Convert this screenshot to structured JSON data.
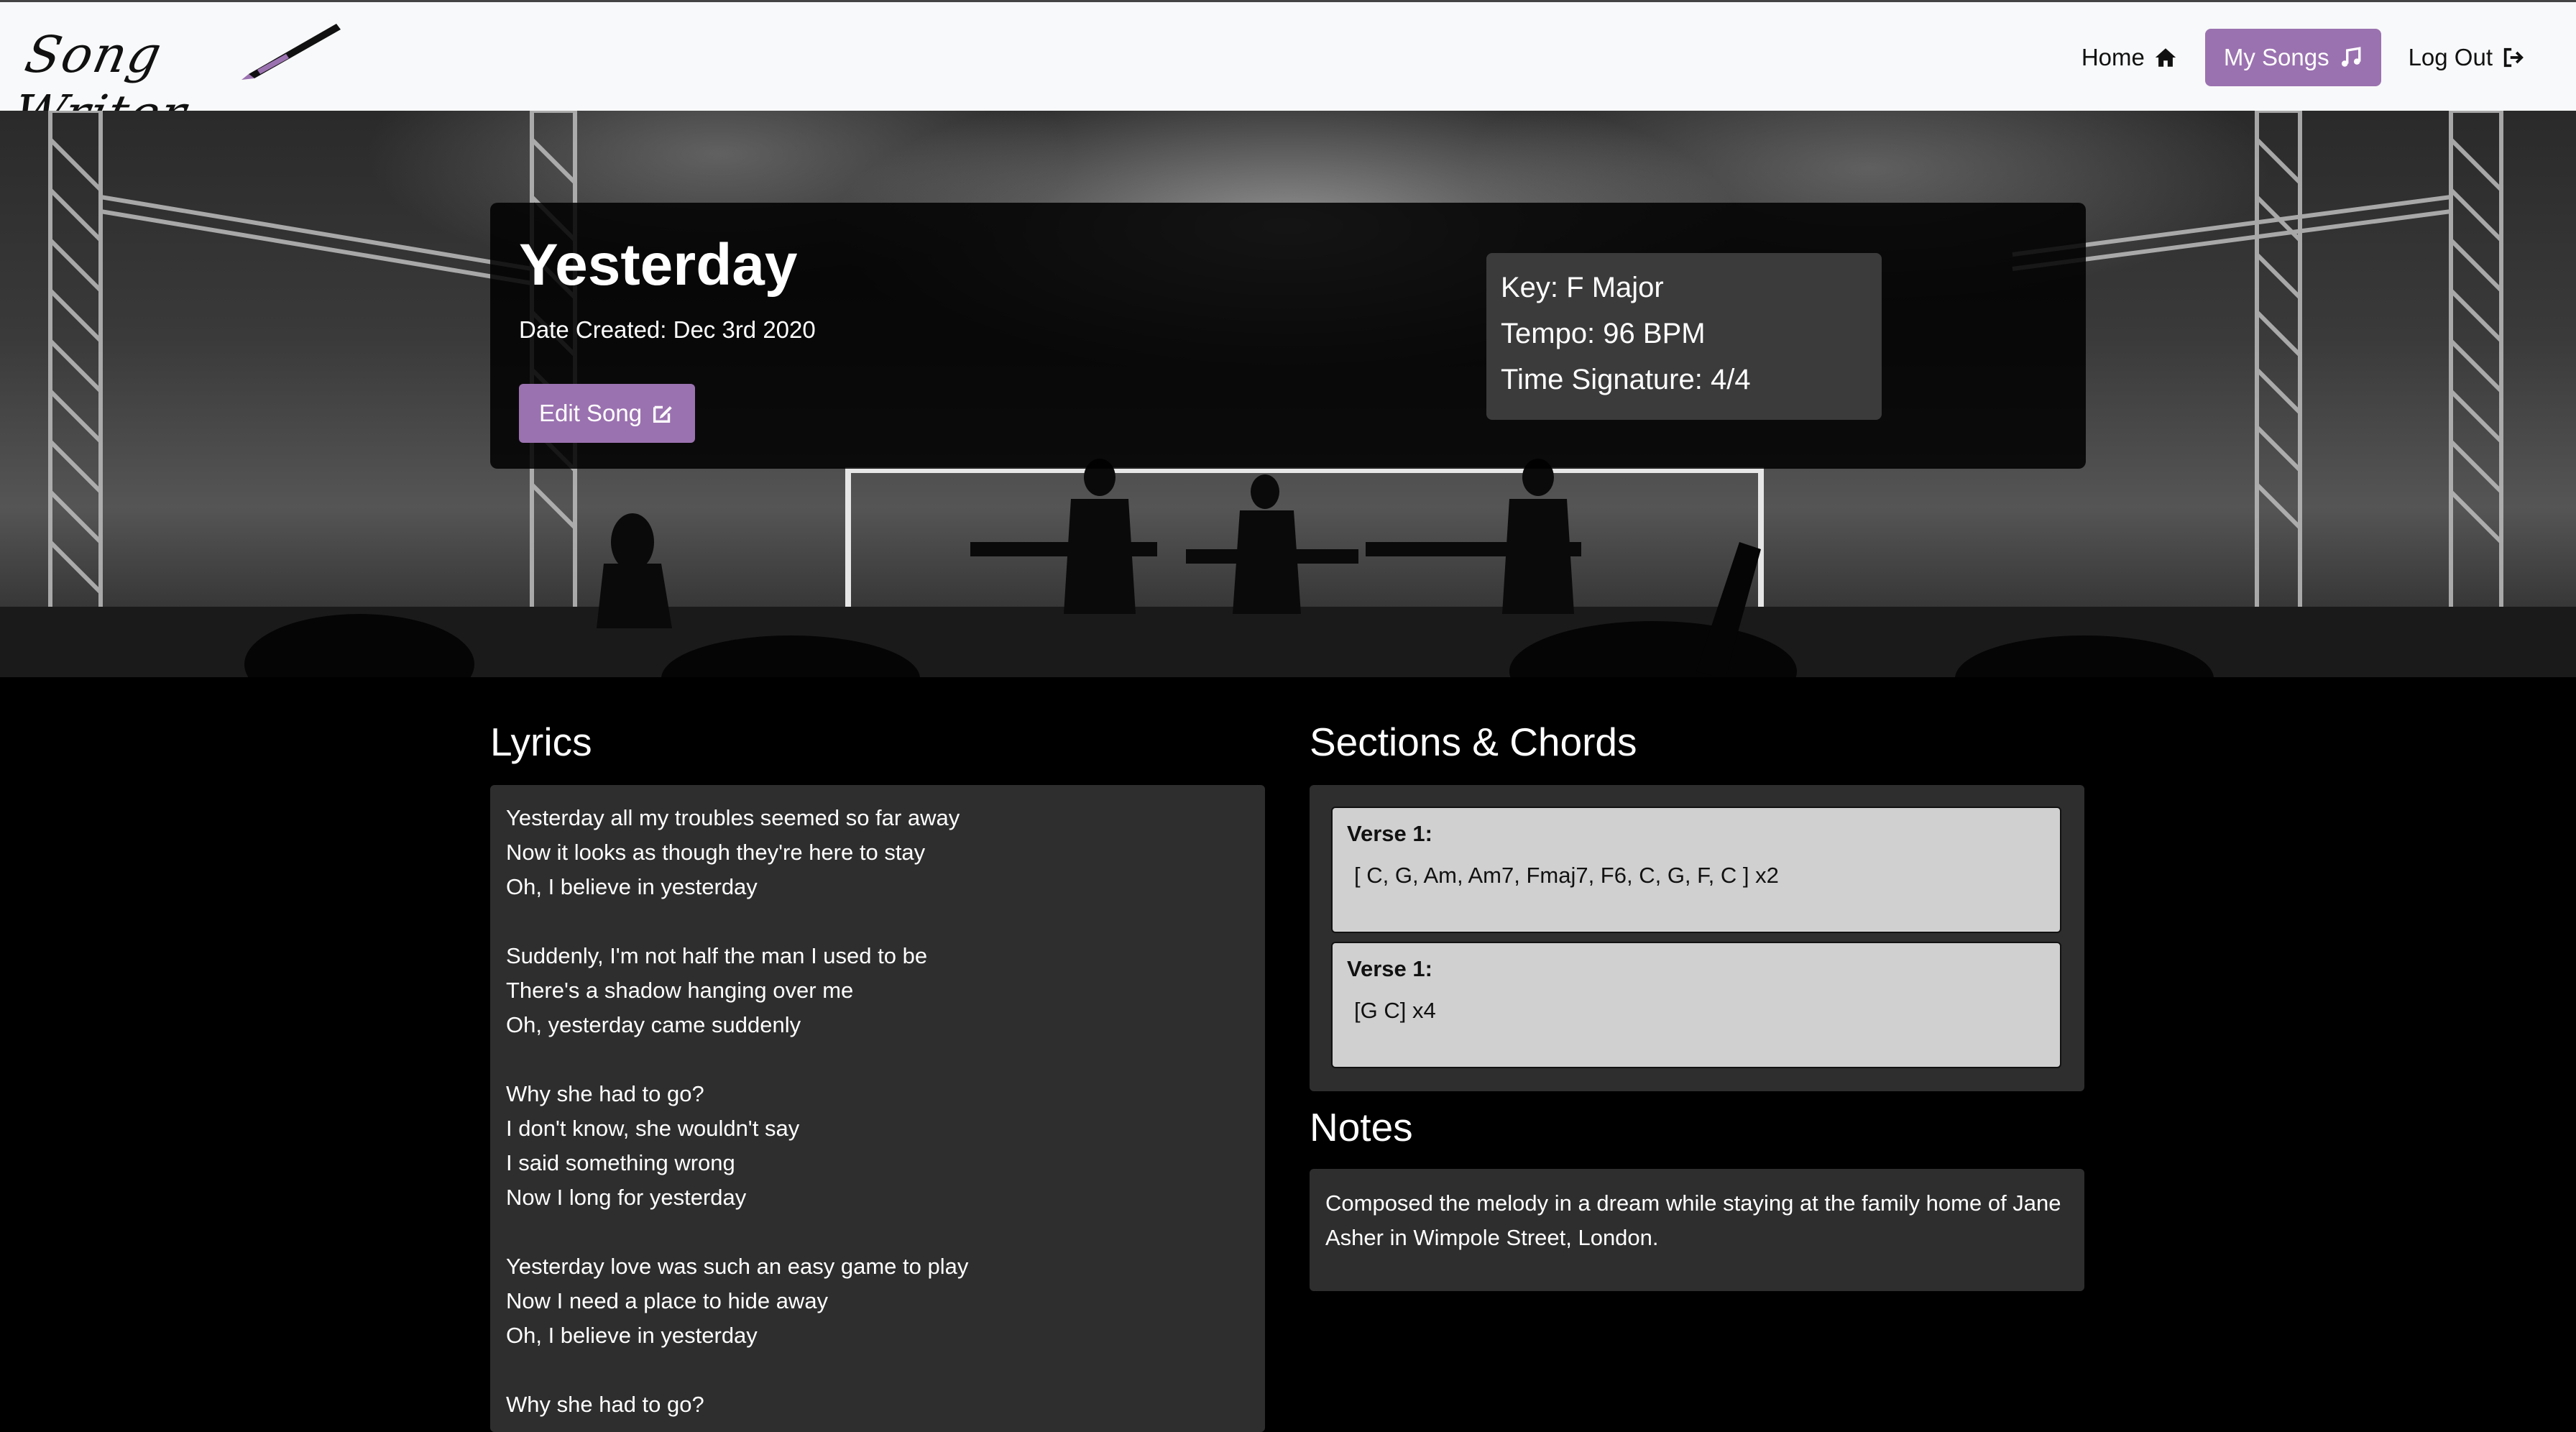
{
  "app": {
    "logo_text": "Song Writer"
  },
  "nav": {
    "home_label": "Home",
    "my_songs_label": "My Songs",
    "logout_label": "Log Out"
  },
  "song": {
    "title": "Yesterday",
    "date_created": "Date Created: Dec 3rd 2020",
    "edit_label": "Edit Song",
    "key": "Key: F Major",
    "tempo": "Tempo: 96 BPM",
    "time_signature": "Time Signature: 4/4"
  },
  "lyrics": {
    "heading": "Lyrics",
    "lines": [
      "Yesterday all my troubles seemed so far away",
      "Now it looks as though they're here to stay",
      "Oh, I believe in yesterday",
      "",
      "Suddenly, I'm not half the man I used to be",
      "There's a shadow hanging over me",
      "Oh, yesterday came suddenly",
      "",
      "Why she had to go?",
      "I don't know, she wouldn't say",
      "I said something wrong",
      "Now I long for yesterday",
      "",
      "Yesterday love was such an easy game to play",
      "Now I need a place to hide away",
      "Oh, I believe in yesterday",
      "",
      "Why she had to go?"
    ]
  },
  "sections": {
    "heading": "Sections & Chords",
    "items": [
      {
        "label": "Verse 1:",
        "chords": "[ C, G, Am, Am7, Fmaj7, F6, C, G, F, C ] x2"
      },
      {
        "label": "Verse 1:",
        "chords": "[G C] x4"
      }
    ]
  },
  "notes": {
    "heading": "Notes",
    "text": "Composed the melody in a dream while staying at the family home of Jane Asher in Wimpole Street, London."
  },
  "colors": {
    "accent": "#9b72b0",
    "navbar_bg": "#f8f9fa",
    "panel_bg": "#2e2e2e",
    "chord_card_bg": "#d0d0d0"
  },
  "icons": {
    "home": "home-icon",
    "my_songs": "music-note-icon",
    "logout": "sign-out-icon",
    "edit": "edit-icon"
  }
}
